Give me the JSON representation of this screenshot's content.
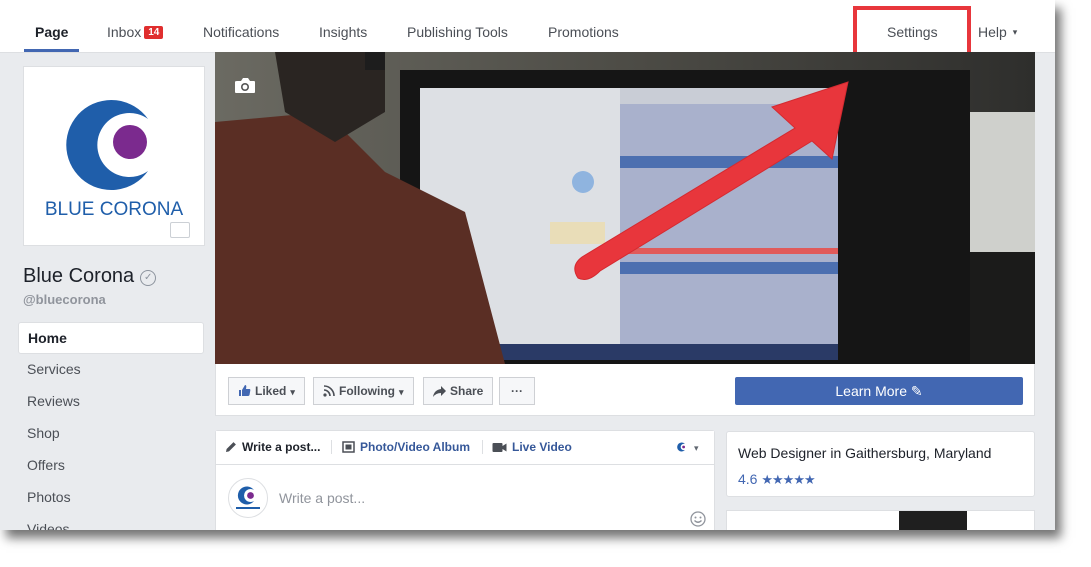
{
  "topnav": {
    "tabs": [
      {
        "label": "Page"
      },
      {
        "label": "Inbox"
      },
      {
        "label": "Notifications"
      },
      {
        "label": "Insights"
      },
      {
        "label": "Publishing Tools"
      },
      {
        "label": "Promotions"
      },
      {
        "label": "Settings"
      },
      {
        "label": "Help"
      }
    ],
    "inbox_count": "14",
    "help_caret": "▾"
  },
  "page": {
    "logo_text": "BLUE CORONA",
    "name": "Blue Corona",
    "verified_glyph": "✓",
    "handle": "@bluecorona"
  },
  "sidenav": {
    "items": [
      {
        "label": "Home"
      },
      {
        "label": "Services"
      },
      {
        "label": "Reviews"
      },
      {
        "label": "Shop"
      },
      {
        "label": "Offers"
      },
      {
        "label": "Photos"
      },
      {
        "label": "Videos"
      }
    ]
  },
  "actions": {
    "liked": "Liked",
    "following": "Following",
    "share": "Share",
    "more": "···",
    "learn_more": "Learn More ✎",
    "caret": "▾"
  },
  "composer": {
    "write_post": "Write a post...",
    "photo_album": "Photo/Video Album",
    "live_video": "Live Video",
    "placeholder": "Write a post...",
    "audience_caret": "▾"
  },
  "about": {
    "category": "Web Designer in Gaithersburg, Maryland",
    "rating": "4.6",
    "stars": "★★★★★"
  },
  "colors": {
    "brand_blue": "#4267b2",
    "logo_blue": "#1f5eaa",
    "logo_purple": "#7b2a8e",
    "badge_red": "#e02e2e",
    "annotation_red": "#e8363c"
  }
}
